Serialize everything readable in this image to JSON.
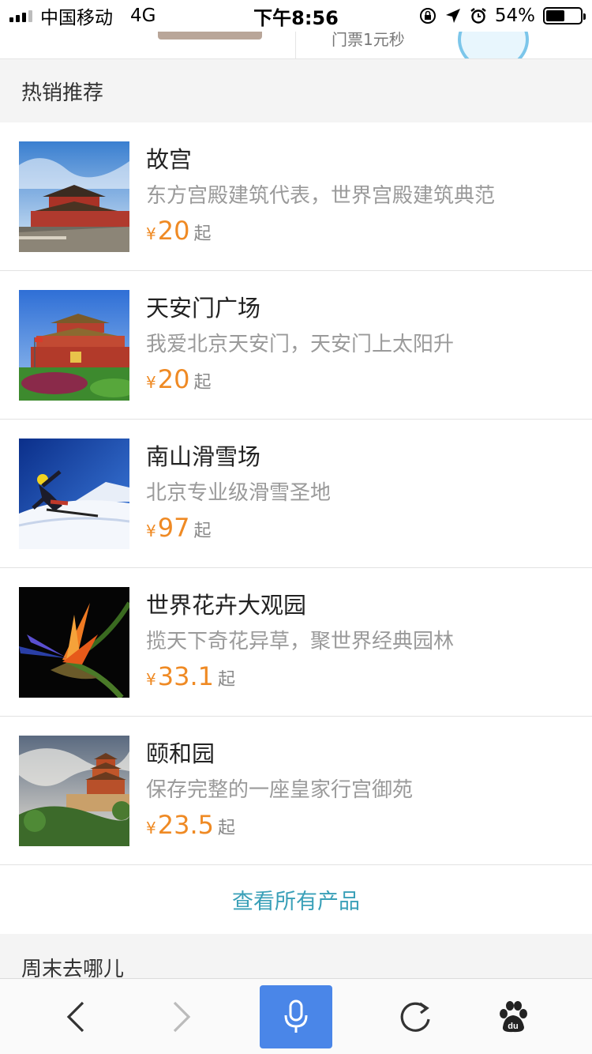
{
  "status_bar": {
    "carrier": "中国移动",
    "network": "4G",
    "time": "下午8:56",
    "battery_percent": "54%",
    "battery_level": 0.54
  },
  "top_partial": {
    "cut_text": "门票1元秒"
  },
  "hot_section": {
    "title": "热销推荐",
    "items": [
      {
        "title": "故宫",
        "desc": "东方宫殿建筑代表，世界宫殿建筑典范",
        "currency": "¥",
        "price": "20",
        "suffix": "起",
        "image_icon": "forbidden-city-photo"
      },
      {
        "title": "天安门广场",
        "desc": "我爱北京天安门，天安门上太阳升",
        "currency": "¥",
        "price": "20",
        "suffix": "起",
        "image_icon": "tiananmen-photo"
      },
      {
        "title": "南山滑雪场",
        "desc": "北京专业级滑雪圣地",
        "currency": "¥",
        "price": "97",
        "suffix": "起",
        "image_icon": "ski-photo"
      },
      {
        "title": "世界花卉大观园",
        "desc": "揽天下奇花异草，聚世界经典园林",
        "currency": "¥",
        "price": "33.1",
        "suffix": "起",
        "image_icon": "bird-of-paradise-flower-photo"
      },
      {
        "title": "颐和园",
        "desc": "保存完整的一座皇家行宫御苑",
        "currency": "¥",
        "price": "23.5",
        "suffix": "起",
        "image_icon": "summer-palace-photo"
      }
    ],
    "view_all_label": "查看所有产品"
  },
  "weekend_section": {
    "title": "周末去哪儿"
  },
  "bottom_nav": {
    "items": [
      "back-icon",
      "forward-icon",
      "microphone-icon",
      "refresh-icon",
      "baidu-paw-icon"
    ]
  },
  "colors": {
    "price": "#ef8a24",
    "link": "#3aa0b8",
    "voice_button": "#4a86e8",
    "section_bg": "#f4f4f4"
  }
}
